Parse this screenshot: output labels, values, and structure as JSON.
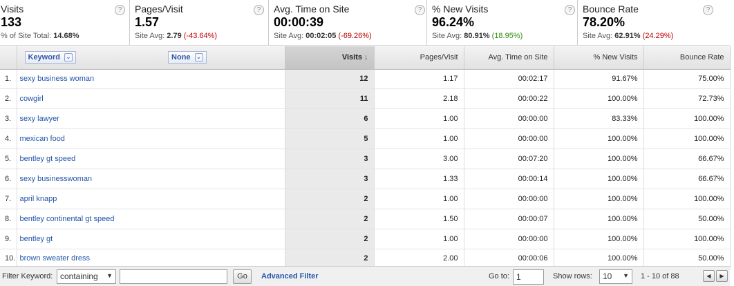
{
  "summary": [
    {
      "label": "Visits",
      "value": "133",
      "sub_prefix": "% of Site Total: ",
      "sub_value": "14.68%",
      "sub_change": "",
      "change_class": ""
    },
    {
      "label": "Pages/Visit",
      "value": "1.57",
      "sub_prefix": "Site Avg: ",
      "sub_value": "2.79",
      "sub_change": "(-43.64%)",
      "change_class": "neg"
    },
    {
      "label": "Avg. Time on Site",
      "value": "00:00:39",
      "sub_prefix": "Site Avg: ",
      "sub_value": "00:02:05",
      "sub_change": "(-69.26%)",
      "change_class": "neg"
    },
    {
      "label": "% New Visits",
      "value": "96.24%",
      "sub_prefix": "Site Avg: ",
      "sub_value": "80.91%",
      "sub_change": "(18.95%)",
      "change_class": "pos"
    },
    {
      "label": "Bounce Rate",
      "value": "78.20%",
      "sub_prefix": "Site Avg: ",
      "sub_value": "62.91%",
      "sub_change": "(24.29%)",
      "change_class": "neg"
    }
  ],
  "help_glyph": "?",
  "table": {
    "dimension_primary": "Keyword",
    "dimension_secondary": "None",
    "columns": [
      "Visits",
      "Pages/Visit",
      "Avg. Time on Site",
      "% New Visits",
      "Bounce Rate"
    ],
    "sort_glyph": "↓",
    "rows": [
      {
        "idx": "1.",
        "keyword": "sexy business woman",
        "visits": "12",
        "ppv": "1.17",
        "time": "00:02:17",
        "new": "91.67%",
        "bounce": "75.00%"
      },
      {
        "idx": "2.",
        "keyword": "cowgirl",
        "visits": "11",
        "ppv": "2.18",
        "time": "00:00:22",
        "new": "100.00%",
        "bounce": "72.73%"
      },
      {
        "idx": "3.",
        "keyword": "sexy lawyer",
        "visits": "6",
        "ppv": "1.00",
        "time": "00:00:00",
        "new": "83.33%",
        "bounce": "100.00%"
      },
      {
        "idx": "4.",
        "keyword": "mexican food",
        "visits": "5",
        "ppv": "1.00",
        "time": "00:00:00",
        "new": "100.00%",
        "bounce": "100.00%"
      },
      {
        "idx": "5.",
        "keyword": "bentley gt speed",
        "visits": "3",
        "ppv": "3.00",
        "time": "00:07:20",
        "new": "100.00%",
        "bounce": "66.67%"
      },
      {
        "idx": "6.",
        "keyword": "sexy businesswoman",
        "visits": "3",
        "ppv": "1.33",
        "time": "00:00:14",
        "new": "100.00%",
        "bounce": "66.67%"
      },
      {
        "idx": "7.",
        "keyword": "april knapp",
        "visits": "2",
        "ppv": "1.00",
        "time": "00:00:00",
        "new": "100.00%",
        "bounce": "100.00%"
      },
      {
        "idx": "8.",
        "keyword": "bentley continental gt speed",
        "visits": "2",
        "ppv": "1.50",
        "time": "00:00:07",
        "new": "100.00%",
        "bounce": "50.00%"
      },
      {
        "idx": "9.",
        "keyword": "bentley gt",
        "visits": "2",
        "ppv": "1.00",
        "time": "00:00:00",
        "new": "100.00%",
        "bounce": "100.00%"
      },
      {
        "idx": "10.",
        "keyword": "brown sweater dress",
        "visits": "2",
        "ppv": "2.00",
        "time": "00:00:06",
        "new": "100.00%",
        "bounce": "50.00%"
      }
    ]
  },
  "footer": {
    "filter_label": "Filter Keyword:",
    "filter_mode": "containing",
    "filter_value": "",
    "go_label": "Go",
    "advanced_label": "Advanced Filter",
    "goto_label": "Go to:",
    "goto_value": "1",
    "show_rows_label": "Show rows:",
    "show_rows_value": "10",
    "range_text": "1 - 10 of 88",
    "prev_glyph": "◀",
    "next_glyph": "▶",
    "dropdown_glyph": "▼"
  }
}
